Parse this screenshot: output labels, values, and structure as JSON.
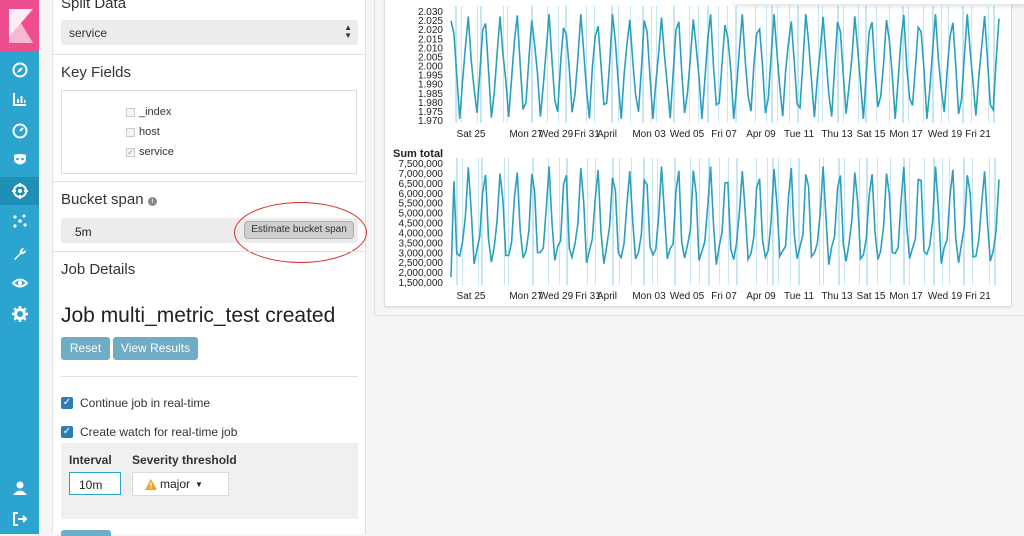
{
  "panel": {
    "split_data_title": "Split Data",
    "split_value": "service",
    "key_fields_title": "Key Fields",
    "key_fields": [
      {
        "label": "_index",
        "checked": false
      },
      {
        "label": "host",
        "checked": false
      },
      {
        "label": "service",
        "checked": true
      }
    ],
    "bucket_span_title": "Bucket span",
    "bucket_span_value": "5m",
    "estimate_label": "Estimate bucket span",
    "job_details_title": "Job Details",
    "job_created": "Job multi_metric_test created",
    "reset_label": "Reset",
    "view_results_label": "View Results",
    "continue_realtime": "Continue job in real-time",
    "create_watch": "Create watch for real-time job",
    "interval_label": "Interval",
    "interval_value": "10m",
    "severity_label": "Severity threshold",
    "severity_value": "major"
  },
  "colors": {
    "line": "#2b9fbe",
    "band": "#c8e6f2",
    "accent": "#2ba5cf",
    "annotation": "#d9302a"
  },
  "chart_data": [
    {
      "type": "line",
      "title": "",
      "y_ticks": [
        "2.030",
        "2.025",
        "2.020",
        "2.015",
        "2.010",
        "2.005",
        "2.000",
        "1.995",
        "1.990",
        "1.985",
        "1.980",
        "1.975",
        "1.970"
      ],
      "x_ticks": [
        "Sat 25",
        "Mon 27",
        "Wed 29",
        "Fri 31",
        "April",
        "Mon 03",
        "Wed 05",
        "Fri 07",
        "Apr 09",
        "Tue 11",
        "Thu 13",
        "Sat 15",
        "Mon 17",
        "Wed 19",
        "Fri 21"
      ],
      "ylim": [
        1.97,
        2.03
      ]
    },
    {
      "type": "line",
      "title": "Sum total",
      "y_ticks": [
        "7,500,000",
        "7,000,000",
        "6,500,000",
        "6,000,000",
        "5,500,000",
        "5,000,000",
        "4,500,000",
        "4,000,000",
        "3,500,000",
        "3,000,000",
        "2,500,000",
        "2,000,000",
        "1,500,000"
      ],
      "x_ticks": [
        "Sat 25",
        "Mon 27",
        "Wed 29",
        "Fri 31",
        "April",
        "Mon 03",
        "Wed 05",
        "Fri 07",
        "Apr 09",
        "Tue 11",
        "Thu 13",
        "Sat 15",
        "Mon 17",
        "Wed 19",
        "Fri 21"
      ],
      "ylim": [
        1500000,
        7500000
      ]
    }
  ]
}
